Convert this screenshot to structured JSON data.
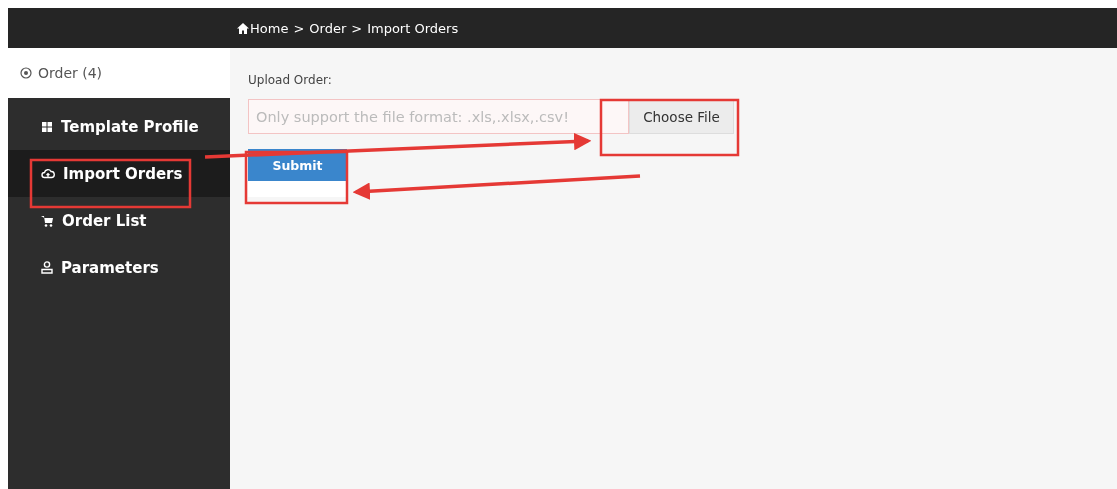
{
  "breadcrumb": {
    "items": [
      "Home",
      "Order",
      "Import Orders"
    ],
    "separator": ">"
  },
  "sidebar": {
    "header": "Order (4)",
    "items": [
      {
        "kind": "grid",
        "label": "Template Profile",
        "selected": false
      },
      {
        "kind": "cloud",
        "label": "Import Orders",
        "selected": true
      },
      {
        "kind": "cart",
        "label": "Order List",
        "selected": false
      },
      {
        "kind": "person",
        "label": "Parameters",
        "selected": false
      }
    ]
  },
  "upload": {
    "label": "Upload Order:",
    "placeholder": "Only support the file format: .xls,.xlsx,.csv!",
    "choose_button": "Choose File",
    "submit_button": "Submit"
  }
}
